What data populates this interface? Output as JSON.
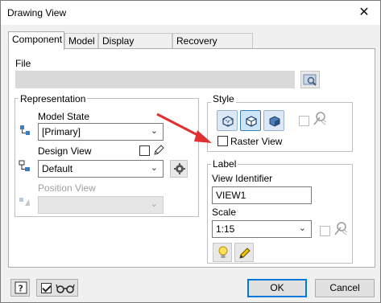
{
  "window": {
    "title": "Drawing View",
    "close_label": "✕"
  },
  "tabs": [
    {
      "label": "Component",
      "active": true
    },
    {
      "label": "Model",
      "active": false
    },
    {
      "label": "Display Options",
      "active": false
    },
    {
      "label": "Recovery Options",
      "active": false
    }
  ],
  "file": {
    "label": "File",
    "value": "",
    "browse_icon": "browse-file-icon"
  },
  "representation": {
    "title": "Representation",
    "model_state": {
      "label": "Model State",
      "value": "[Primary]"
    },
    "design_view": {
      "label": "Design View",
      "value": "Default",
      "associative_checked": false
    },
    "position_view": {
      "label": "Position View",
      "value": "",
      "disabled": true
    }
  },
  "style": {
    "title": "Style",
    "buttons": [
      "hidden-line-icon",
      "hidden-line-removed-icon",
      "shaded-icon"
    ],
    "selected_index": 1,
    "style_from_base_checked": false,
    "raster_view": {
      "label": "Raster View",
      "checked": false
    }
  },
  "label_group": {
    "title": "Label",
    "view_identifier": {
      "label": "View Identifier",
      "value": "VIEW1"
    },
    "scale": {
      "label": "Scale",
      "value": "1:15"
    },
    "scale_from_base_checked": false
  },
  "footer": {
    "ok_label": "OK",
    "cancel_label": "Cancel",
    "help_icon": "help-icon",
    "glasses_checked": true
  },
  "annotation": {
    "arrow_color": "#e03030"
  }
}
